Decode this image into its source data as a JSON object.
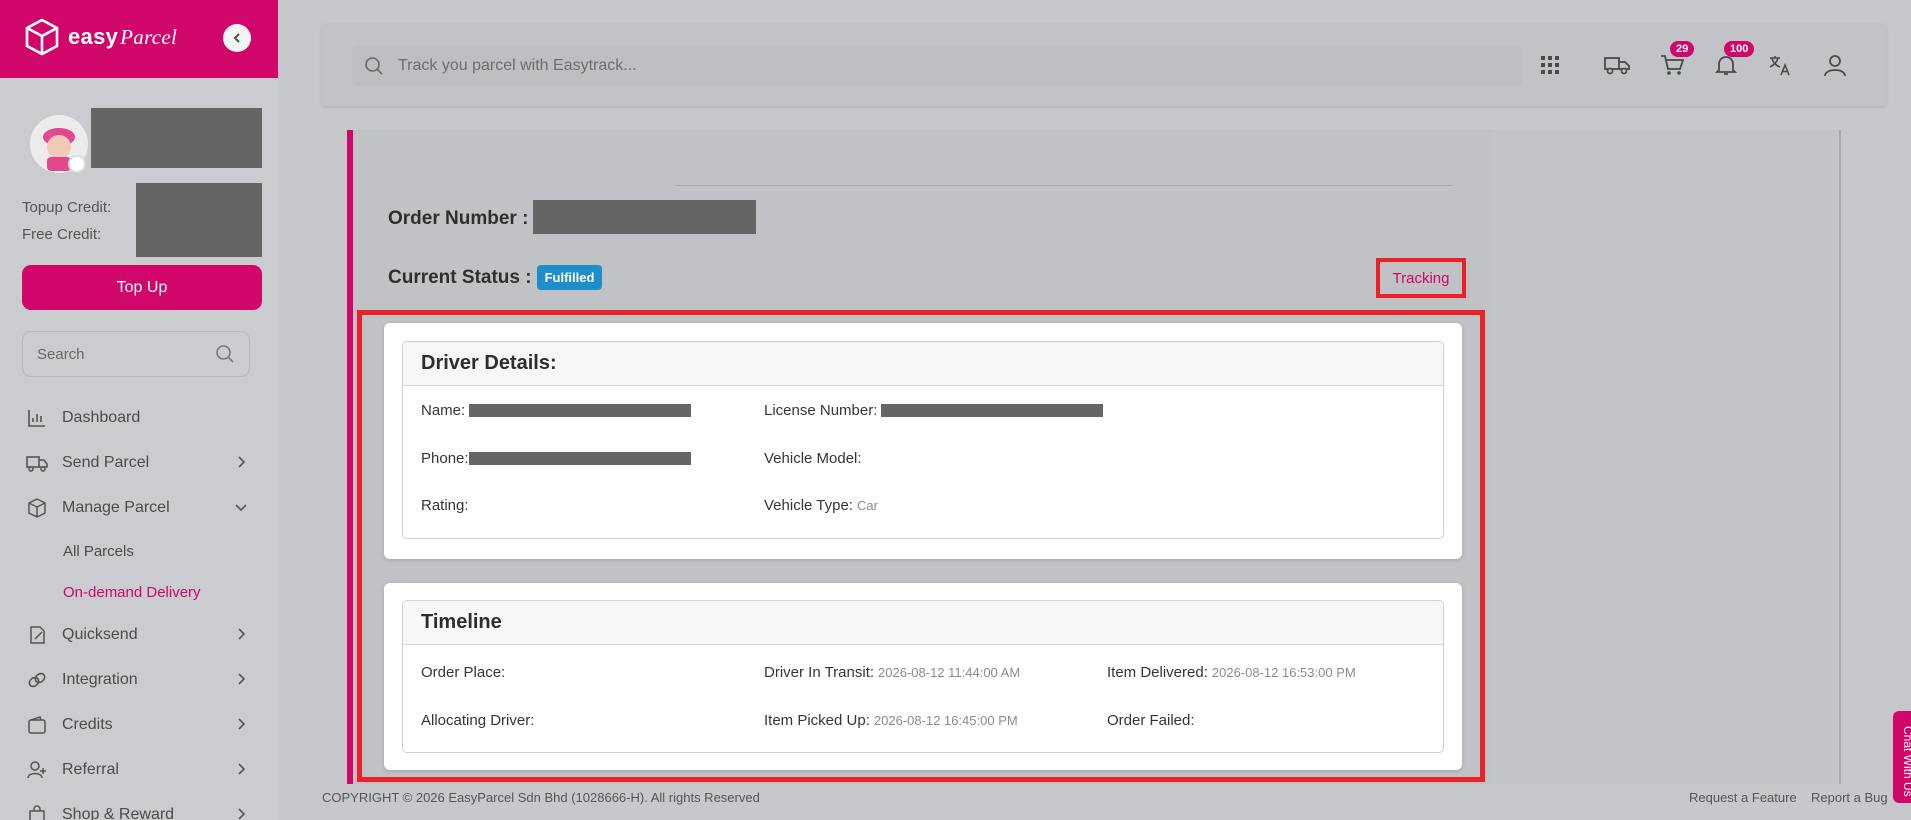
{
  "brand": {
    "name": "easy",
    "name_italic": "Parcel",
    "primary_color": "#d1066a"
  },
  "sidebar": {
    "credits": {
      "topup_label": "Topup Credit:",
      "free_label": "Free Credit:"
    },
    "topup_button": "Top Up",
    "search_placeholder": "Search",
    "nav": [
      {
        "label": "Dashboard",
        "icon": "chart-icon"
      },
      {
        "label": "Send Parcel",
        "icon": "truck-icon"
      },
      {
        "label": "Manage Parcel",
        "icon": "box-icon"
      },
      {
        "label": "Quicksend",
        "icon": "edit-icon"
      },
      {
        "label": "Integration",
        "icon": "link-icon"
      },
      {
        "label": "Credits",
        "icon": "wallet-icon"
      },
      {
        "label": "Referral",
        "icon": "user-plus-icon"
      },
      {
        "label": "Shop & Reward",
        "icon": "bag-icon"
      }
    ],
    "sub_items": [
      {
        "label": "All Parcels"
      },
      {
        "label": "On-demand Delivery",
        "active": true
      }
    ]
  },
  "topbar": {
    "search_placeholder": "Track you parcel with Easytrack...",
    "cart_count": "29",
    "notification_count": "100"
  },
  "order": {
    "number_label": "Order Number :",
    "status_label": "Current Status :",
    "status": "Fulfilled",
    "status_color": "#1c8fc9",
    "tracking_link": "Tracking"
  },
  "driver": {
    "title": "Driver Details:",
    "name_label": "Name:",
    "phone_label": "Phone:",
    "rating_label": "Rating:",
    "license_label": "License Number:",
    "vehicle_model_label": "Vehicle Model:",
    "vehicle_type_label": "Vehicle Type:",
    "vehicle_type": "Car"
  },
  "timeline": {
    "title": "Timeline",
    "order_place_label": "Order Place:",
    "allocating_label": "Allocating Driver:",
    "in_transit_label": "Driver In Transit:",
    "in_transit_time": "2026-08-12 11:44:00 AM",
    "picked_up_label": "Item Picked Up:",
    "picked_up_time": "2026-08-12 16:45:00 PM",
    "delivered_label": "Item Delivered:",
    "delivered_time": "2026-08-12 16:53:00 PM",
    "failed_label": "Order Failed:"
  },
  "footer": {
    "copyright": "COPYRIGHT © 2026 EasyParcel Sdn Bhd (1028666-H). All rights Reserved",
    "request_feature": "Request a Feature",
    "report_bug": "Report a Bug",
    "chat": "Chat With Us"
  }
}
